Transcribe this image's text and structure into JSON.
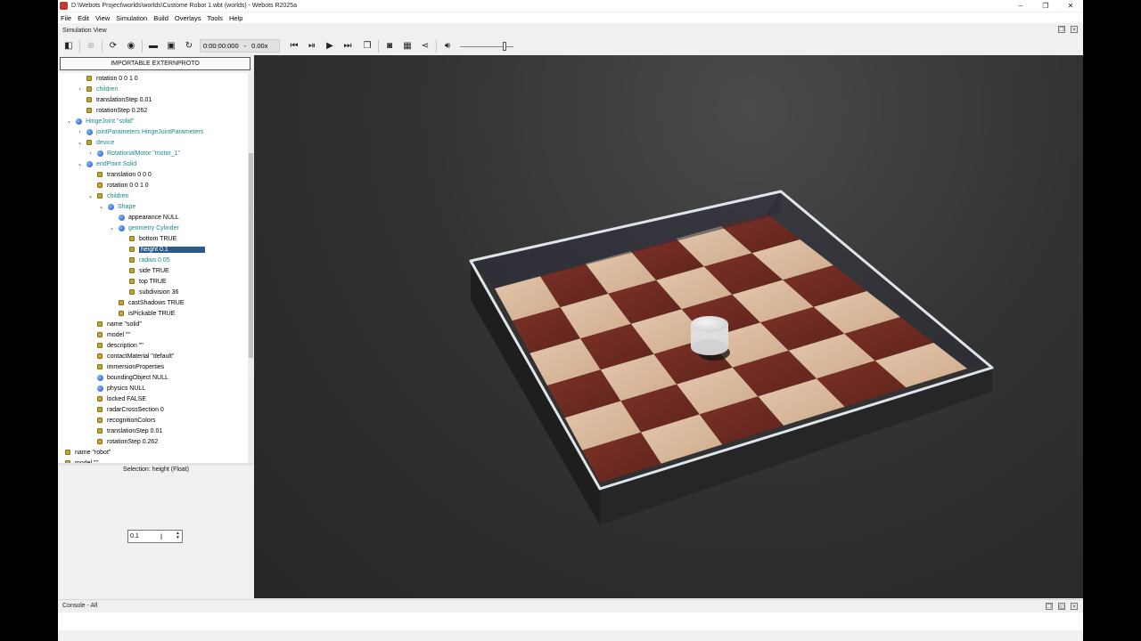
{
  "window": {
    "title": "D:\\Webots Project\\worlds\\worlds\\Custome Robot 1.wbt (worlds) - Webots R2025a",
    "minimize": "–",
    "maximize": "❐",
    "close": "✕"
  },
  "menu": [
    "File",
    "Edit",
    "View",
    "Simulation",
    "Build",
    "Overlays",
    "Tools",
    "Help"
  ],
  "panel_title": "Simulation View",
  "toolbar": {
    "time": "0:00:00:000",
    "speed_sep": "-",
    "speed": "0.00x"
  },
  "left": {
    "proto_button": "IMPORTABLE EXTERNPROTO",
    "tree": [
      {
        "text": "rotation 0 0 1 0",
        "type": "field"
      },
      {
        "text": "children",
        "type": "field",
        "teal": true,
        "arrow": "›"
      },
      {
        "text": "translationStep 0.01",
        "type": "field"
      },
      {
        "text": "rotationStep 0.262",
        "type": "field"
      },
      {
        "text": "HingeJoint \"solid\"",
        "type": "node",
        "teal": true,
        "arrow": "⌄"
      },
      {
        "text": "jointParameters HingeJointParameters",
        "type": "node",
        "teal": true,
        "arrow": "›"
      },
      {
        "text": "device",
        "type": "field",
        "teal": true,
        "arrow": "⌄"
      },
      {
        "text": "RotationalMotor \"motor_1\"",
        "type": "node",
        "teal": true,
        "arrow": "›"
      },
      {
        "text": "endPoint Solid",
        "type": "node",
        "teal": true,
        "arrow": "⌄"
      },
      {
        "text": "translation 0 0 0",
        "type": "field"
      },
      {
        "text": "rotation 0 0 1 0",
        "type": "field"
      },
      {
        "text": "children",
        "type": "field",
        "teal": true,
        "arrow": "⌄"
      },
      {
        "text": "Shape",
        "type": "node",
        "teal": true,
        "arrow": "⌄"
      },
      {
        "text": "appearance NULL",
        "type": "node"
      },
      {
        "text": "geometry Cylinder",
        "type": "node",
        "teal": true,
        "arrow": "⌄"
      },
      {
        "text": "bottom TRUE",
        "type": "field"
      },
      {
        "text": "height 0.1",
        "type": "field",
        "selected": true
      },
      {
        "text": "radius 0.05",
        "type": "field",
        "teal": true
      },
      {
        "text": "side TRUE",
        "type": "field"
      },
      {
        "text": "top TRUE",
        "type": "field"
      },
      {
        "text": "subdivision 36",
        "type": "field"
      },
      {
        "text": "castShadows TRUE",
        "type": "field"
      },
      {
        "text": "isPickable TRUE",
        "type": "field"
      },
      {
        "text": "name \"solid\"",
        "type": "field"
      },
      {
        "text": "model \"\"",
        "type": "field"
      },
      {
        "text": "description \"\"",
        "type": "field"
      },
      {
        "text": "contactMaterial \"default\"",
        "type": "field"
      },
      {
        "text": "immersionProperties",
        "type": "field"
      },
      {
        "text": "boundingObject NULL",
        "type": "node"
      },
      {
        "text": "physics NULL",
        "type": "node"
      },
      {
        "text": "locked FALSE",
        "type": "field"
      },
      {
        "text": "radarCrossSection 0",
        "type": "field"
      },
      {
        "text": "recognitionColors",
        "type": "field"
      },
      {
        "text": "translationStep 0.01",
        "type": "field"
      },
      {
        "text": "rotationStep 0.262",
        "type": "field"
      },
      {
        "text": "name \"robot\"",
        "type": "field"
      },
      {
        "text": "model \"\"",
        "type": "field"
      }
    ],
    "selection_info": "Selection: height (Float)",
    "value_input": "0.1"
  },
  "console": {
    "label": "Console - All"
  },
  "colors": {
    "tile_light": "#d8b79a",
    "tile_dark": "#6e2b22",
    "wall": "#cfd6dc",
    "selection": "#2b5b8c",
    "teal_text": "#1a8a8a"
  }
}
